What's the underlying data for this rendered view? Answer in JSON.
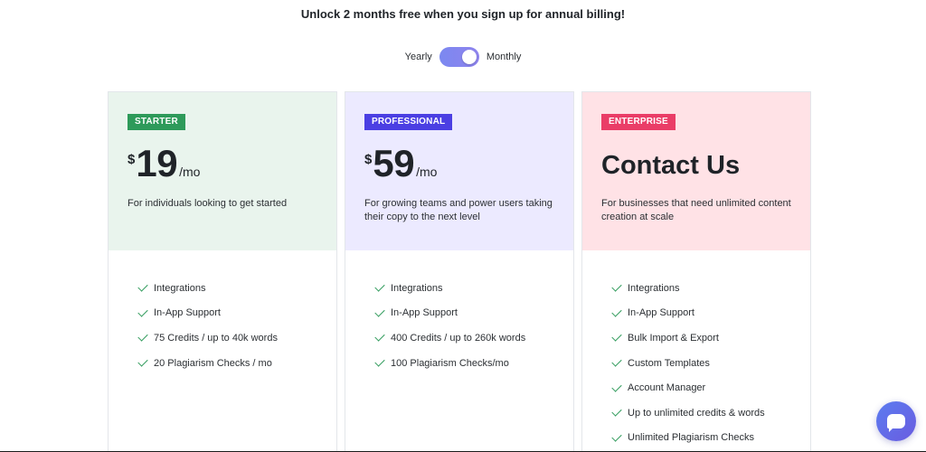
{
  "banner": {
    "text": "Unlock 2 months free when you sign up for annual billing!"
  },
  "billing": {
    "yearly_label": "Yearly",
    "monthly_label": "Monthly",
    "selected": "Monthly"
  },
  "colors": {
    "starter_badge": "#2e9a5a",
    "professional_badge": "#4b3fe3",
    "enterprise_badge": "#ea3d67",
    "check": "#2e9a5a",
    "toggle": "#7b88f0"
  },
  "plans": [
    {
      "badge": "STARTER",
      "currency": "$",
      "amount": "19",
      "period": "/mo",
      "description": "For individuals looking to get started",
      "features": [
        "Integrations",
        "In-App Support",
        "75 Credits / up to 40k words",
        "20 Plagiarism Checks / mo"
      ]
    },
    {
      "badge": "PROFESSIONAL",
      "currency": "$",
      "amount": "59",
      "period": "/mo",
      "description": "For growing teams and power users taking their copy to the next level",
      "features": [
        "Integrations",
        "In-App Support",
        "400 Credits / up to 260k words",
        "100 Plagiarism Checks/mo"
      ]
    },
    {
      "badge": "ENTERPRISE",
      "headline": "Contact Us",
      "description": "For businesses that need unlimited content creation at scale",
      "features": [
        "Integrations",
        "In-App Support",
        "Bulk Import & Export",
        "Custom Templates",
        "Account Manager",
        "Up to unlimited credits & words",
        "Unlimited Plagiarism Checks"
      ]
    }
  ],
  "chat": {
    "icon": "chat-bubble-icon"
  }
}
